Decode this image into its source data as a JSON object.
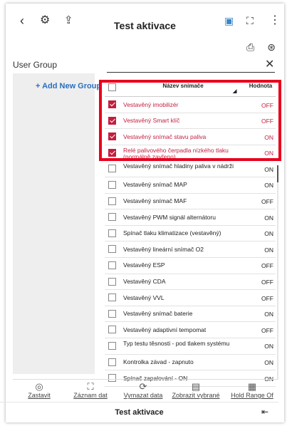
{
  "header": {
    "title": "Test aktivace"
  },
  "user_group": {
    "label": "User Group",
    "add_label": "+ Add New Group"
  },
  "table": {
    "col_name": "Název snímače",
    "col_value": "Hodnota",
    "rows": [
      {
        "name": "Vestavěný imobilizér",
        "value": "OFF",
        "checked": true
      },
      {
        "name": "Vestavěný Smart klíč",
        "value": "OFF",
        "checked": true
      },
      {
        "name": "Vestavěný snímač stavu paliva",
        "value": "ON",
        "checked": true
      },
      {
        "name": "Relé palivového čerpadla nízkého tlaku (normálně zavřeno)",
        "value": "ON",
        "checked": true
      },
      {
        "name": "Vestavěný snímač hladiny paliva v nádrži",
        "value": "ON",
        "checked": false
      },
      {
        "name": "Vestavěný snímač MAP",
        "value": "ON",
        "checked": false
      },
      {
        "name": "Vestavěný snímač MAF",
        "value": "OFF",
        "checked": false
      },
      {
        "name": "Vestavěný PWM signál alternátoru",
        "value": "ON",
        "checked": false
      },
      {
        "name": "Spínač tlaku klimatizace (vestavěný)",
        "value": "ON",
        "checked": false
      },
      {
        "name": "Vestavěný lineární snímač O2",
        "value": "ON",
        "checked": false
      },
      {
        "name": "Vestavěný ESP",
        "value": "OFF",
        "checked": false
      },
      {
        "name": "Vestavěný CDA",
        "value": "OFF",
        "checked": false
      },
      {
        "name": "Vestavěný VVL",
        "value": "OFF",
        "checked": false
      },
      {
        "name": "Vestavěný snímač baterie",
        "value": "ON",
        "checked": false
      },
      {
        "name": "Vestavěný adaptivní tempomat",
        "value": "OFF",
        "checked": false
      },
      {
        "name": "Typ testu těsnosti - pod tlakem systému",
        "value": "ON",
        "checked": false
      },
      {
        "name": "Kontrolka závad - zapnuto",
        "value": "ON",
        "checked": false
      },
      {
        "name": "Spínač zapalování - ON",
        "value": "ON",
        "checked": false
      }
    ]
  },
  "toolbar": {
    "stop": "Zastavit",
    "record": "Záznam dat",
    "clear": "Vymazat data",
    "show_selected": "Zobrazit vybrané",
    "hold_range": "Hold Range Of"
  },
  "bottom": {
    "title": "Test aktivace"
  },
  "colors": {
    "accent": "#c21f3f",
    "highlight": "#e8001c"
  }
}
